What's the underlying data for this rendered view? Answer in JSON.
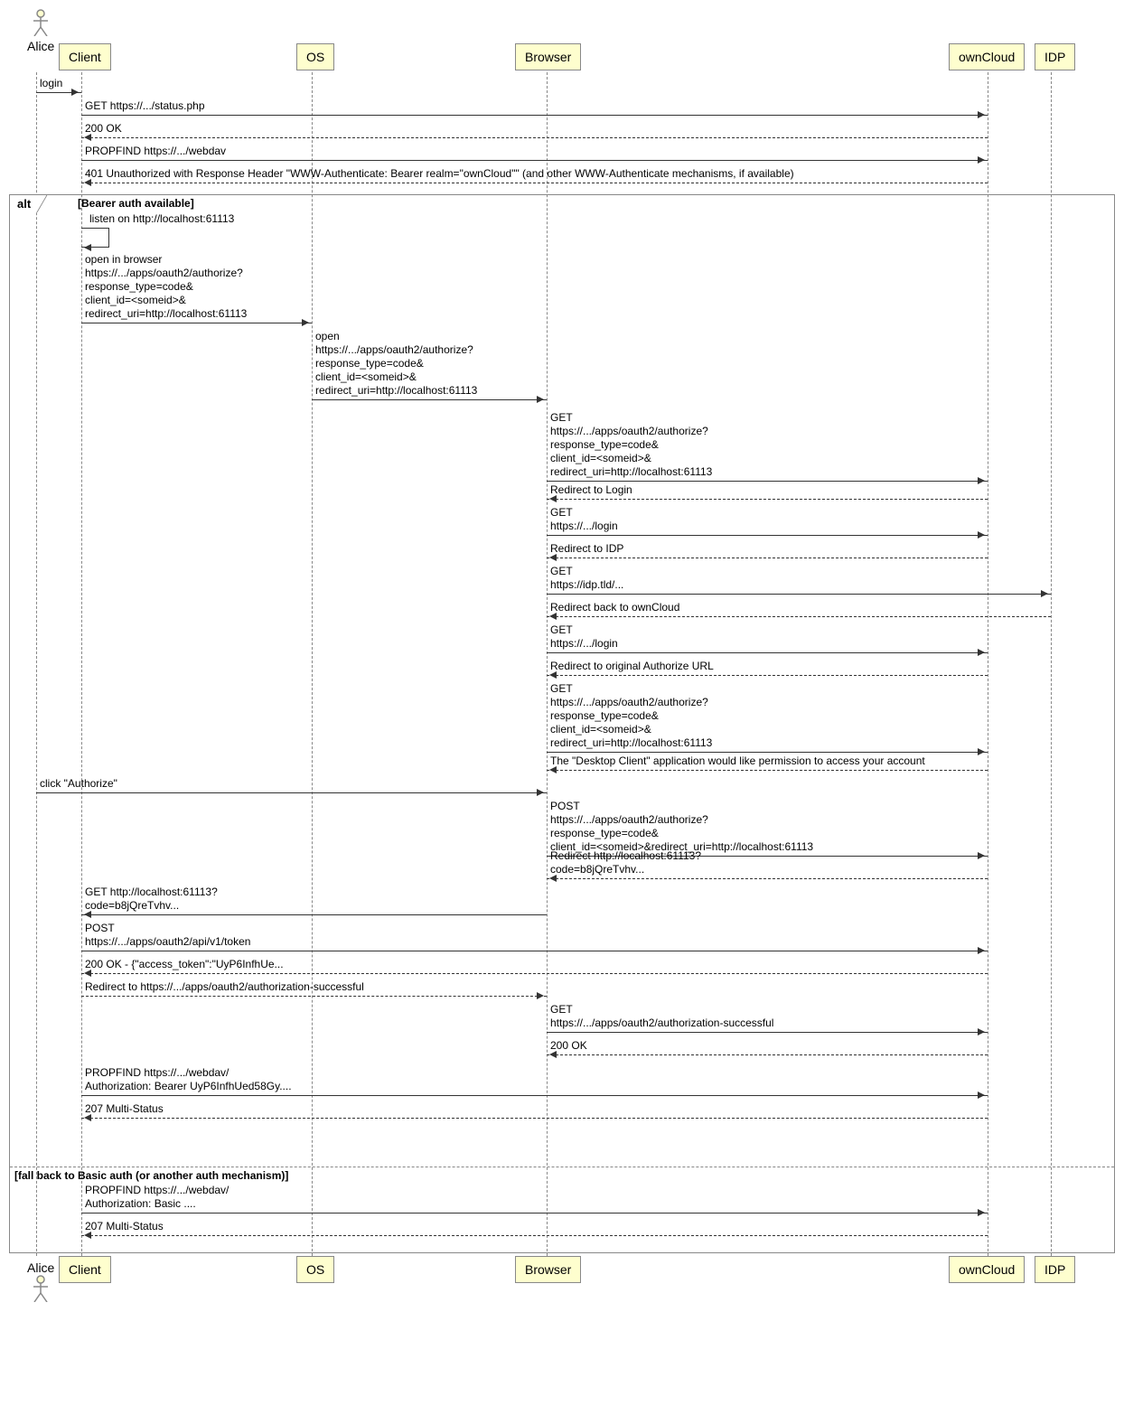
{
  "participants": {
    "alice": "Alice",
    "client": "Client",
    "os": "OS",
    "browser": "Browser",
    "owncloud": "ownCloud",
    "idp": "IDP"
  },
  "messages": {
    "login": "login",
    "get_status": "GET https://.../status.php",
    "ok200": "200 OK",
    "propfind": "PROPFIND https://.../webdav",
    "unauth": "401 Unauthorized with Response Header \"WWW-Authenticate: Bearer realm=\"ownCloud\"\" (and other WWW-Authenticate mechanisms, if available)",
    "listen": "listen on http://localhost:61113",
    "open_browser": "open in browser\nhttps://.../apps/oauth2/authorize?\nresponse_type=code&\nclient_id=<someid>&\nredirect_uri=http://localhost:61113",
    "os_open": "open\nhttps://.../apps/oauth2/authorize?\nresponse_type=code&\nclient_id=<someid>&\nredirect_uri=http://localhost:61113",
    "get_auth": "GET\nhttps://.../apps/oauth2/authorize?\nresponse_type=code&\nclient_id=<someid>&\nredirect_uri=http://localhost:61113",
    "redir_login": "Redirect to Login",
    "get_login": "GET\nhttps://.../login",
    "redir_idp": "Redirect to IDP",
    "get_idp": "GET\nhttps://idp.tld/...",
    "redir_back": "Redirect back to ownCloud",
    "get_login2": "GET\nhttps://.../login",
    "redir_orig": "Redirect to original Authorize URL",
    "get_auth2": "GET\nhttps://.../apps/oauth2/authorize?\nresponse_type=code&\nclient_id=<someid>&\nredirect_uri=http://localhost:61113",
    "perm": "The \"Desktop Client\" application would like permission to access your account",
    "click_auth": "click \"Authorize\"",
    "post_auth": "POST\nhttps://.../apps/oauth2/authorize?\nresponse_type=code&\nclient_id=<someid>&redirect_uri=http://localhost:61113",
    "redir_code": "Redirect http://localhost:61113?\ncode=b8jQreTvhv...",
    "get_code": "GET http://localhost:61113?\ncode=b8jQreTvhv...",
    "post_token": "POST\nhttps://.../apps/oauth2/api/v1/token",
    "token_ok": "200 OK - {\"access_token\":\"UyP6InfhUe...",
    "redir_success": "Redirect to https://.../apps/oauth2/authorization-successful",
    "get_success": "GET\nhttps://.../apps/oauth2/authorization-successful",
    "ok200_2": "200 OK",
    "propfind_bearer": "PROPFIND https://.../webdav/\nAuthorization: Bearer UyP6InfhUed58Gy....",
    "multi207": "207 Multi-Status",
    "propfind_basic": "PROPFIND https://.../webdav/\nAuthorization: Basic ....",
    "multi207_2": "207 Multi-Status"
  },
  "alt": {
    "label": "alt",
    "guard1": "[Bearer auth available]",
    "guard2": "[fall back to Basic auth (or another auth mechanism)]"
  }
}
